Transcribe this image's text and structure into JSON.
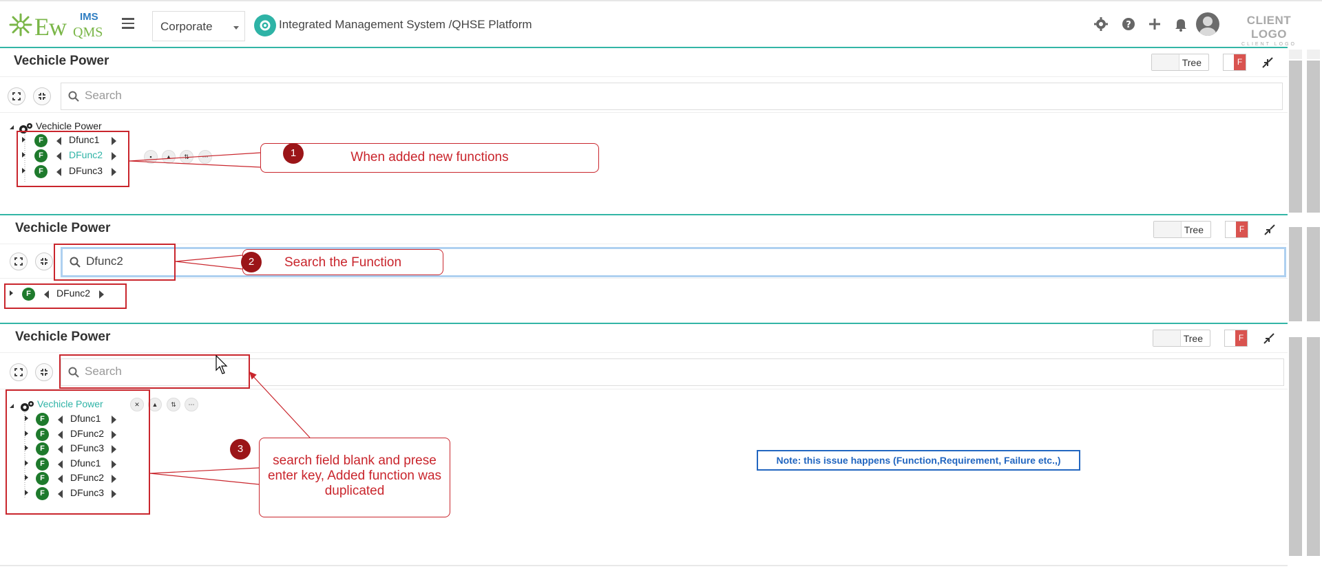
{
  "header": {
    "logo": {
      "ew": "Ew",
      "ims": "IMS",
      "qms": "QMS"
    },
    "company_select": "Corporate",
    "app_title": "Integrated Management System /QHSE Platform",
    "icons": [
      "gear-icon",
      "help-icon",
      "plus-icon",
      "bell-icon",
      "user-avatar-icon"
    ],
    "client_logo": {
      "main": "CLIENT LOGO",
      "sub": "CLIENT LOGO"
    }
  },
  "panels": [
    {
      "title": "Vechicle Power",
      "tree_toggle": "Tree",
      "f_toggle": "F",
      "search": {
        "value": "",
        "placeholder": "Search"
      },
      "root": "Vechicle Power",
      "nodes": [
        "Dfunc1",
        "DFunc2",
        "DFunc3"
      ]
    },
    {
      "title": "Vechicle Power",
      "tree_toggle": "Tree",
      "f_toggle": "F",
      "search": {
        "value": "Dfunc2",
        "placeholder": "Search"
      },
      "nodes": [
        "DFunc2"
      ]
    },
    {
      "title": "Vechicle Power",
      "tree_toggle": "Tree",
      "f_toggle": "F",
      "search": {
        "value": "",
        "placeholder": "Search"
      },
      "root": "Vechicle Power",
      "nodes": [
        "Dfunc1",
        "DFunc2",
        "DFunc3",
        "Dfunc1",
        "DFunc2",
        "DFunc3"
      ]
    }
  ],
  "badge": "F",
  "annotations": {
    "step1": {
      "num": "1",
      "text": "When added new functions"
    },
    "step2": {
      "num": "2",
      "text": "Search the Function"
    },
    "step3": {
      "num": "3",
      "text": "search field blank and prese enter key, Added function was duplicated"
    },
    "note": "Note: this issue happens (Function,Requirement, Failure etc.,)"
  },
  "colors": {
    "accent": "#32b5a6",
    "annotation_red": "#c9252c",
    "badge_green": "#1e7a2c",
    "note_blue": "#2266c0"
  }
}
